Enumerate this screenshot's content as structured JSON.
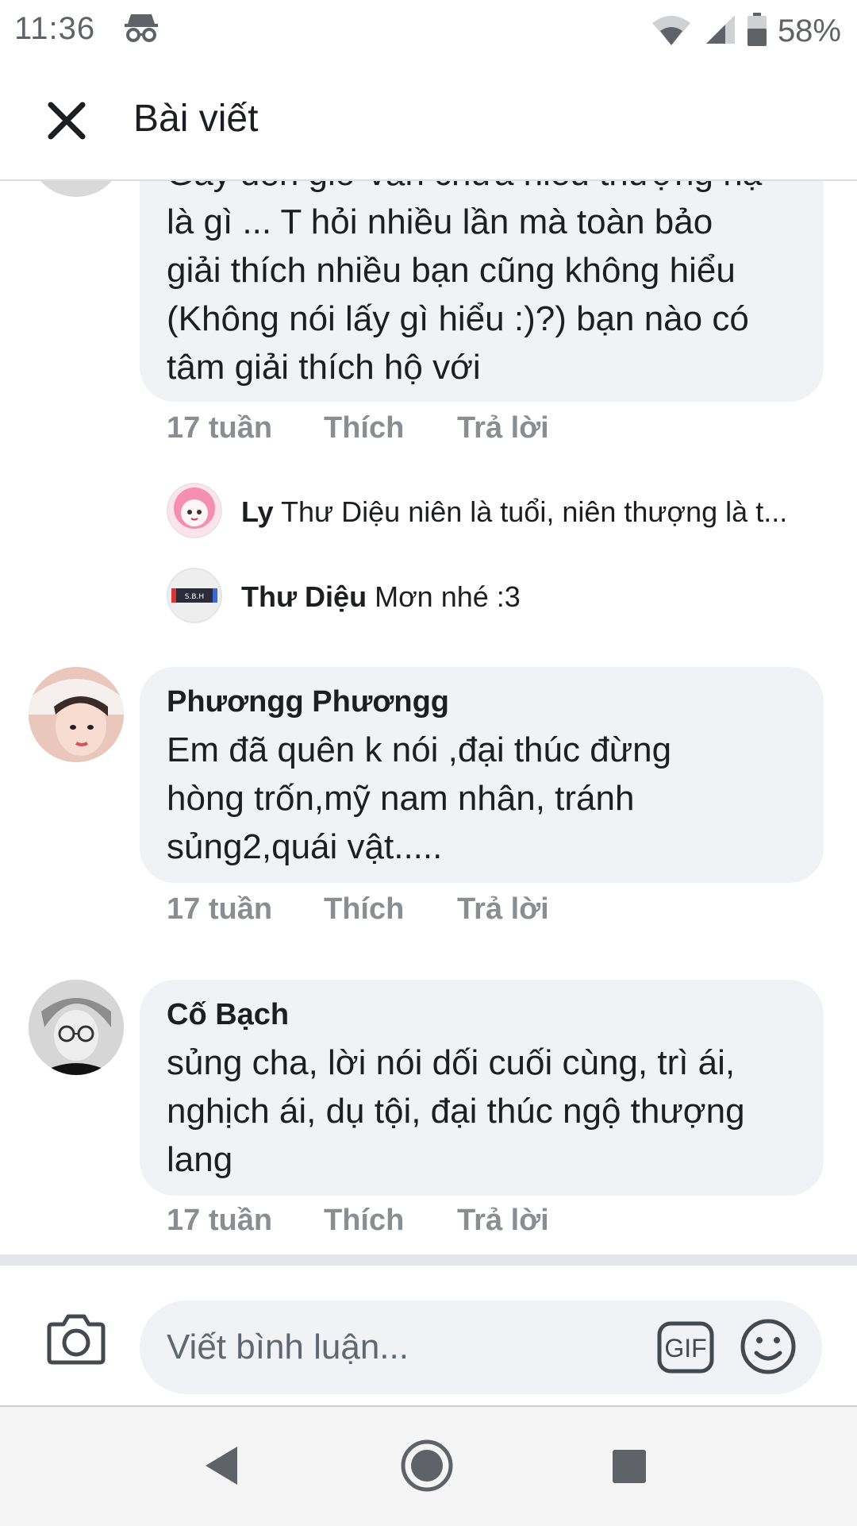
{
  "status_bar": {
    "time": "11:36",
    "battery": "58%"
  },
  "header": {
    "title": "Bài viết"
  },
  "comments": [
    {
      "text_lines": [
        "Gay đến giờ vẫn chưa hiểu thượng hạ",
        "là gì ... T hỏi nhiều lần mà toàn bảo",
        "giải thích nhiều bạn cũng không hiểu",
        "(Không nói lấy gì hiểu :)?) bạn nào có",
        "tâm giải thích hộ với"
      ],
      "time": "17 tuần",
      "like": "Thích",
      "reply": "Trả lời",
      "replies": [
        {
          "name": "Ly",
          "text": "Thư Diệu niên là tuổi, niên thượng là t..."
        },
        {
          "name": "Thư Diệu",
          "text": "Mơn nhé :3"
        }
      ]
    },
    {
      "author": "Phươngg Phươngg",
      "text_lines": [
        "Em đã quên k nói ,đại thúc đừng",
        "hòng trốn,mỹ nam nhân, tránh",
        "sủng2,quái vật....."
      ],
      "time": "17 tuần",
      "like": "Thích",
      "reply": "Trả lời"
    },
    {
      "author": "Cố Bạch",
      "text_lines": [
        "sủng cha, lời nói dối cuối cùng, trì ái,",
        "nghịch ái, dụ tội, đại thúc ngộ thượng",
        "lang"
      ],
      "time": "17 tuần",
      "like": "Thích",
      "reply": "Trả lời"
    }
  ],
  "composer": {
    "placeholder": "Viết bình luận...",
    "gif_label": "GIF"
  },
  "colors": {
    "bubble": "#f0f2f5",
    "meta_text": "#8a8d91",
    "text": "#1c1e21"
  }
}
